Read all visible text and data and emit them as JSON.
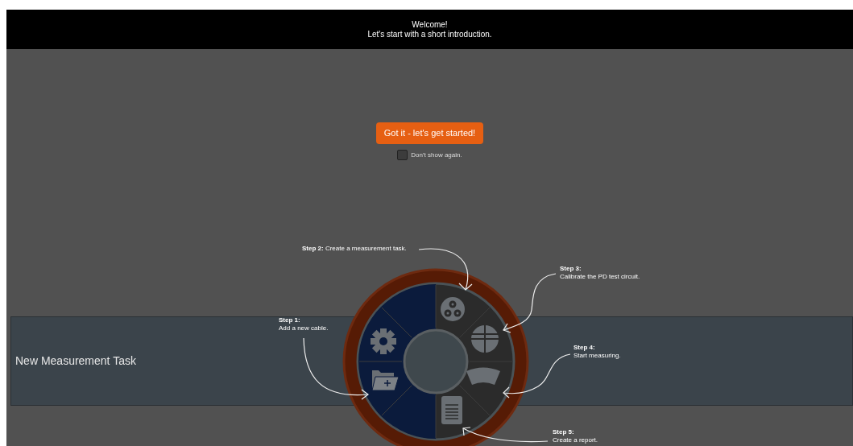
{
  "header": {
    "title": "Welcome!",
    "subtitle": "Let's start with a short introduction."
  },
  "start_button": {
    "label": "Got it - let's get started!"
  },
  "dont_show_again": {
    "label": "Don't show again.",
    "checked": false
  },
  "task_band": {
    "title": "New Measurement Task"
  },
  "steps": [
    {
      "kind": "inline",
      "text": "**Step 2:** Create a measurement task."
    },
    {
      "kind": "stacked",
      "title": "Step 3:",
      "text": "Calibrate the PD test circuit."
    },
    {
      "kind": "stacked",
      "title": "Step 1:",
      "text": "Add a new cable."
    },
    {
      "kind": "stacked",
      "title": "Step 4:",
      "text": "Start measuring."
    },
    {
      "kind": "stacked",
      "title": "Step 5:",
      "text": "Create a report."
    }
  ]
}
